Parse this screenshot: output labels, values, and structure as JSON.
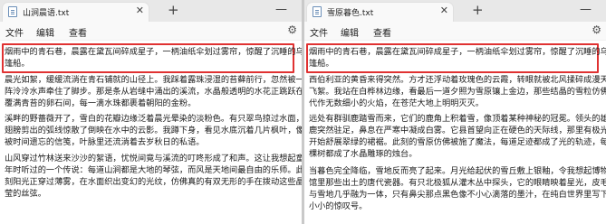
{
  "windows": [
    {
      "tab_title": "山涧晨语.txt",
      "menu": [
        "文件",
        "编辑",
        "查看"
      ],
      "paragraphs": [
        [
          "烟雨中的青石巷，晨露在黛瓦间碎成星子，一柄油纸伞划过雾帘，惊醒了沉睡的乌",
          "篷船。"
        ],
        [
          "晨光如絮，缓缓流淌在青石铺就的山径上。我踩着露珠浸湿的苔藓前行，忽然被一",
          "阵泠泠水声牵住了脚步。那是条从岩缝中涌出的溪流，水晶般透明的水花正跳跃在",
          "覆满青苔的卵石间，每一滴水珠都裹着朝阳的金粉。"
        ],
        [
          "溪畔的野蔷薇开了，雪白的花瓣边缘泛着晨光晕染的淡粉色。有只翠鸟掠过水面，",
          "翅膀剪出的弧线惊散了倒映在水中的云影。我蹲下身，看见水底沉着几片枫叶，像",
          "被时间遗忘的信笺，叶脉里还流淌着去岁秋日的私语。"
        ],
        [
          "山风穿过竹林送来沙沙的絮语，忧悦间竟与溪流的叮咚形成了和声。这让我想起童",
          "年时听过的一个传说：每道山涧都是大地的琴弦，而风是天地间最自由的乐师。此",
          "刻阳光正穿过薄雾，在水面织出变幻的光纹，仿佛真的有双无形的手在拨动这些晶",
          "莹的丝弦。"
        ]
      ]
    },
    {
      "tab_title": "雪原暮色.txt",
      "menu": [
        "文件",
        "编辑",
        "查看"
      ],
      "paragraphs": [
        [
          "烟雨中的青石巷，晨露在黛瓦间碎成星子，一柄油纸伞划过雾帘，惊醒了沉睡的乌",
          "篷船。"
        ],
        [
          "西伯利亚的黄昏来得突然。方才还浮动着玫瑰色的云霞，转眼就被北风揉碎成漫天",
          "飞絮。我站在白桦林边缘，看最后一道夕照为雪原镶上金边，那些结晶的雪粒仿佛时",
          "代作无数细小的火焰，在苍茫大地上明明灭灭。"
        ],
        [
          "远处有群驯鹿踏雪而来，它们的鹿角上积着雪，像顶着某种神秘的冠冕。领头的雄",
          "鹿突然驻足，鼻息在严寒中凝成白雾。它县首望向正在硬色的天际线，那里有极光",
          "开始舒展翠绿的裙裾。此刻的雪原仿佛被施了魔法，每道足迹都成了光的轨迹，每",
          "棵树都成了水晶雕琢的烛台。"
        ],
        [
          "当暮色完全降临，雪地反而亮了起来。月光给起伏的雪丘敷上银釉，令我想起博物",
          "馆里那些出土的唐代瓷器。有只北极狐从灌木丛中探头，它的眼睛映着星光，皮毛",
          "与雪地几乎融为一体，只有鼻尖那点黑色像不小心滴落的墨汁，在纯白世界里写下",
          "小小的惊叹号。"
        ]
      ]
    }
  ]
}
